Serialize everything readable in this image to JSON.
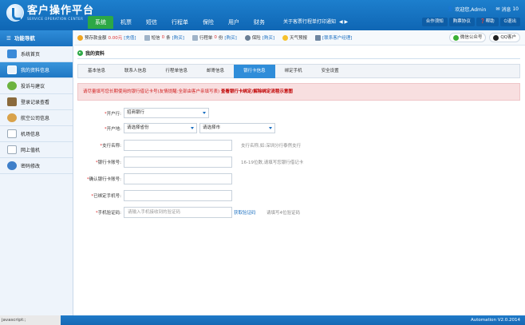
{
  "header": {
    "logo_title": "客户操作平台",
    "logo_sub": "SERVICE OPERATION CENTER",
    "nav": [
      "系统",
      "机票",
      "短信",
      "行程单",
      "保险",
      "用户",
      "财务"
    ],
    "news": "关于客票行程单打印通知",
    "arrows": "◀ ▶",
    "welcome": "欢迎您,Admin",
    "msg_label": "消息",
    "msg_count": "10",
    "buttons": [
      "合作须知",
      "购票协议",
      "帮助",
      "退出"
    ]
  },
  "sidebar": {
    "title": "功能导航",
    "items": [
      "系统首页",
      "我的资料信息",
      "投诉与建议",
      "登录记录查看",
      "航空公司信息",
      "机场信息",
      "网上值机",
      "密码修改"
    ]
  },
  "infobar": {
    "deposit_label": "预存款金额",
    "deposit_value": "0.00元",
    "recharge": "[充值]",
    "sms_label": "短信",
    "sms_value": "0",
    "sms_unit": "条",
    "sms_buy": "[购买]",
    "itinerary_label": "行程单",
    "itinerary_value": "0",
    "itinerary_unit": "份",
    "itinerary_buy": "[购买]",
    "insurance_label": "保险",
    "insurance_buy": "[购买]",
    "weather": "天气预报",
    "contact": "[联系客户经理]",
    "wechat": "微信公众号",
    "qq": "QQ客户"
  },
  "page": {
    "title": "我的资料",
    "tabs": [
      "基本信息",
      "联系人信息",
      "行程单信息",
      "邮寄信息",
      "银行卡信息",
      "绑定手机",
      "安全设置"
    ],
    "active_tab": 4,
    "notice": "请尽量填写您长期使用的银行借记卡号(友情提醒:全部由客户亲填写表)",
    "notice_link": "查看银行卡绑定/解除绑定流程示意图"
  },
  "form": {
    "bank_label": "开户行:",
    "bank_value": "招商银行",
    "location_label": "开户地:",
    "province_value": "请选择省份",
    "city_value": "请选择市",
    "branch_label": "支行名称:",
    "branch_hint": "支行名称,如:深圳分行泰然支行",
    "card_label": "银行卡账号:",
    "card_hint": "16-19位数,请填写您银行借记卡",
    "confirm_label": "确认银行卡账号:",
    "phone_label": "已绑定手机号:",
    "code_label": "手机验证码:",
    "code_placeholder": "请输入手机接收到的验证码",
    "get_code": "获取验证码",
    "code_hint": "请填写4位验证码"
  },
  "status": {
    "js": "javascript:;",
    "version": "Automation  V2.0.2014"
  }
}
